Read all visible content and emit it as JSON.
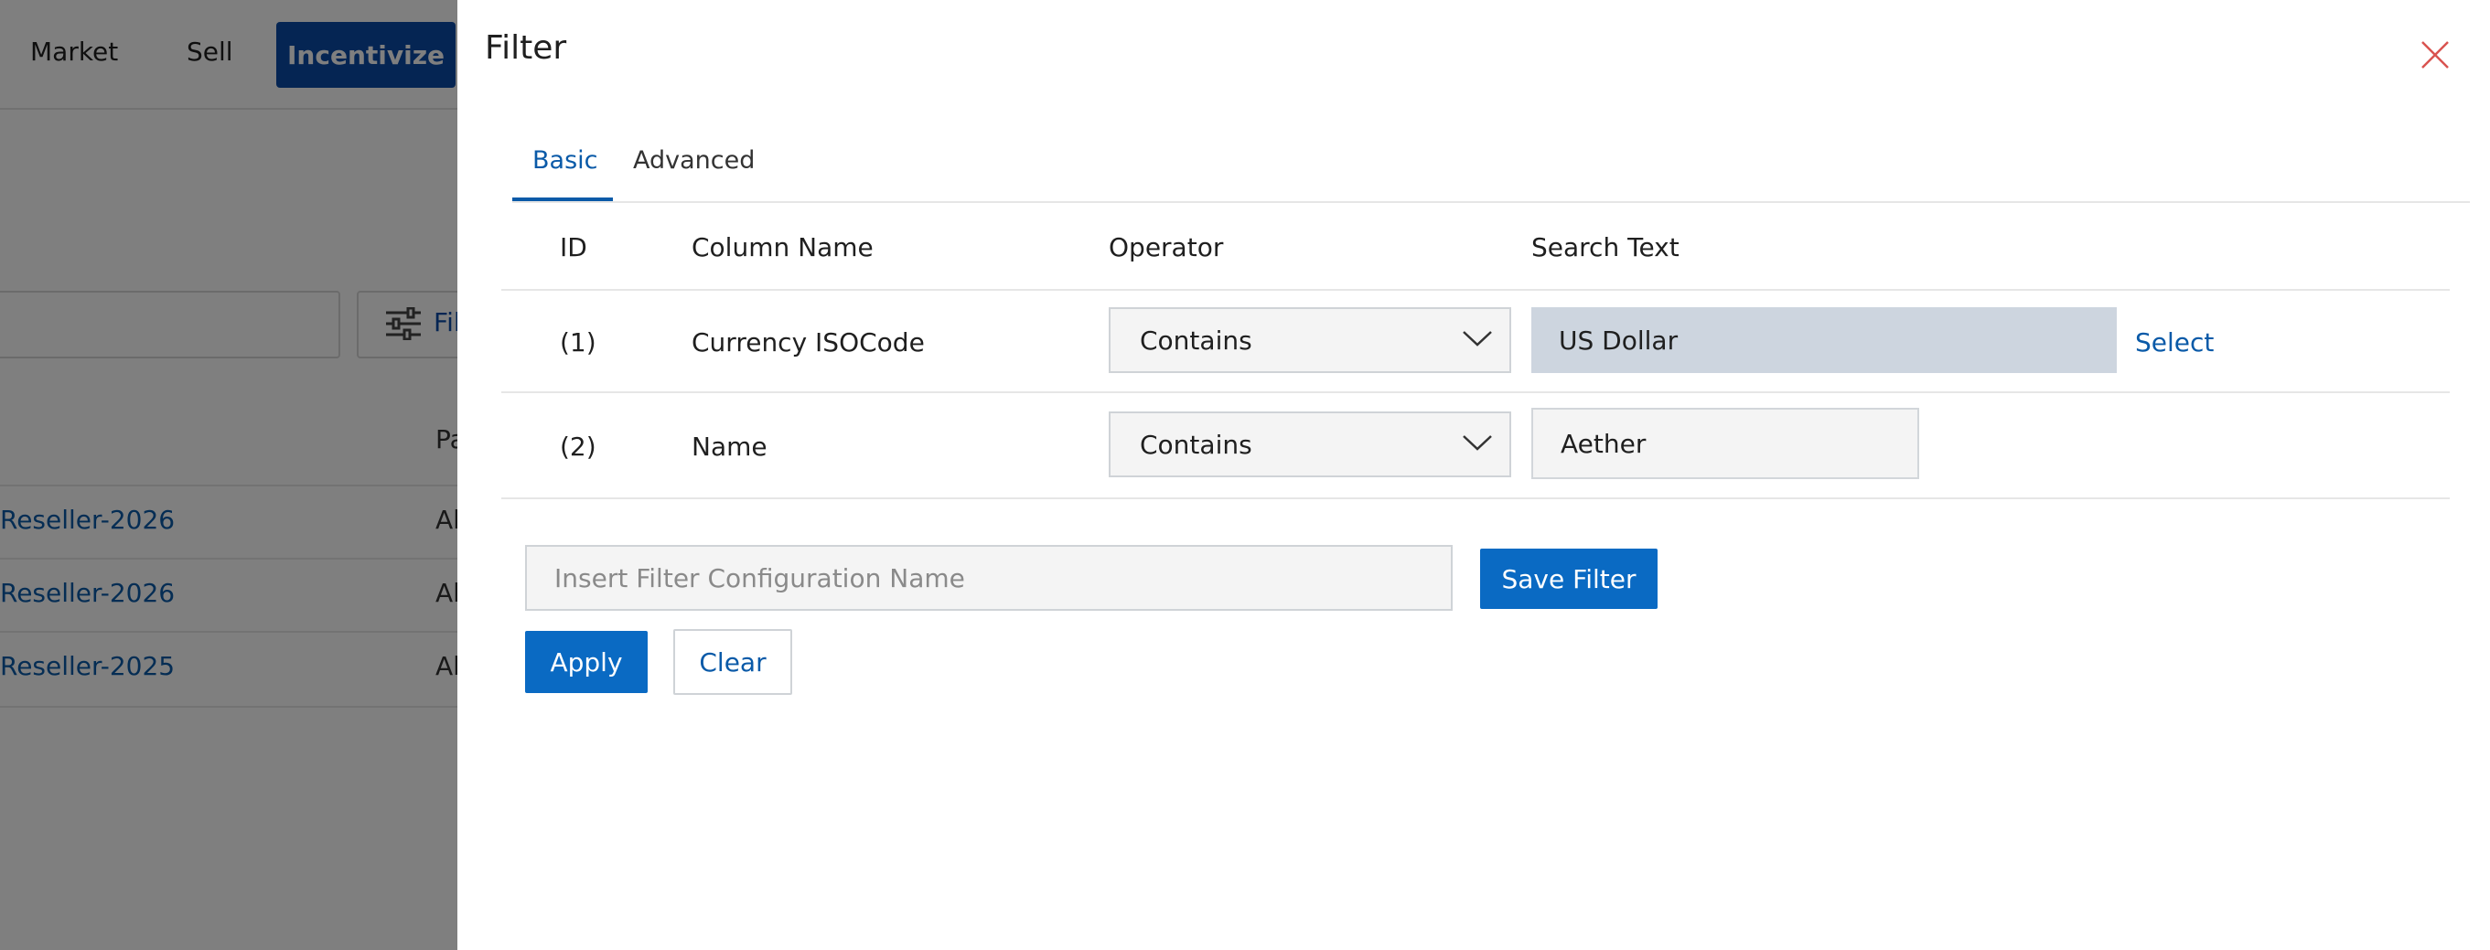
{
  "background": {
    "nav": {
      "market": "Market",
      "sell": "Sell",
      "incentivize": "Incentivize"
    },
    "filter_button_partial": "Fil",
    "column_header_partial": "Pa",
    "rows": [
      {
        "link": "Reseller-2026",
        "partial": "Al"
      },
      {
        "link": "Reseller-2026",
        "partial": "Al"
      },
      {
        "link": "Reseller-2025",
        "partial": "Al"
      }
    ]
  },
  "drawer": {
    "title": "Filter",
    "close_icon": "close-icon",
    "tabs": {
      "basic": "Basic",
      "advanced": "Advanced",
      "active": "Basic"
    },
    "table": {
      "headers": {
        "id": "ID",
        "column_name": "Column Name",
        "operator": "Operator",
        "search_text": "Search Text"
      },
      "rows": [
        {
          "id": "(1)",
          "column": "Currency ISOCode",
          "operator": "Contains",
          "search": "US Dollar",
          "action": "Select"
        },
        {
          "id": "(2)",
          "column": "Name",
          "operator": "Contains",
          "search": "Aether"
        }
      ]
    },
    "config_name_placeholder": "Insert Filter Configuration Name",
    "save_filter": "Save Filter",
    "apply": "Apply",
    "clear": "Clear"
  },
  "colors": {
    "accent": "#0a6ac3",
    "link": "#0a5aa8",
    "close": "#d9534f",
    "readonly_field": "#cdd5df"
  }
}
